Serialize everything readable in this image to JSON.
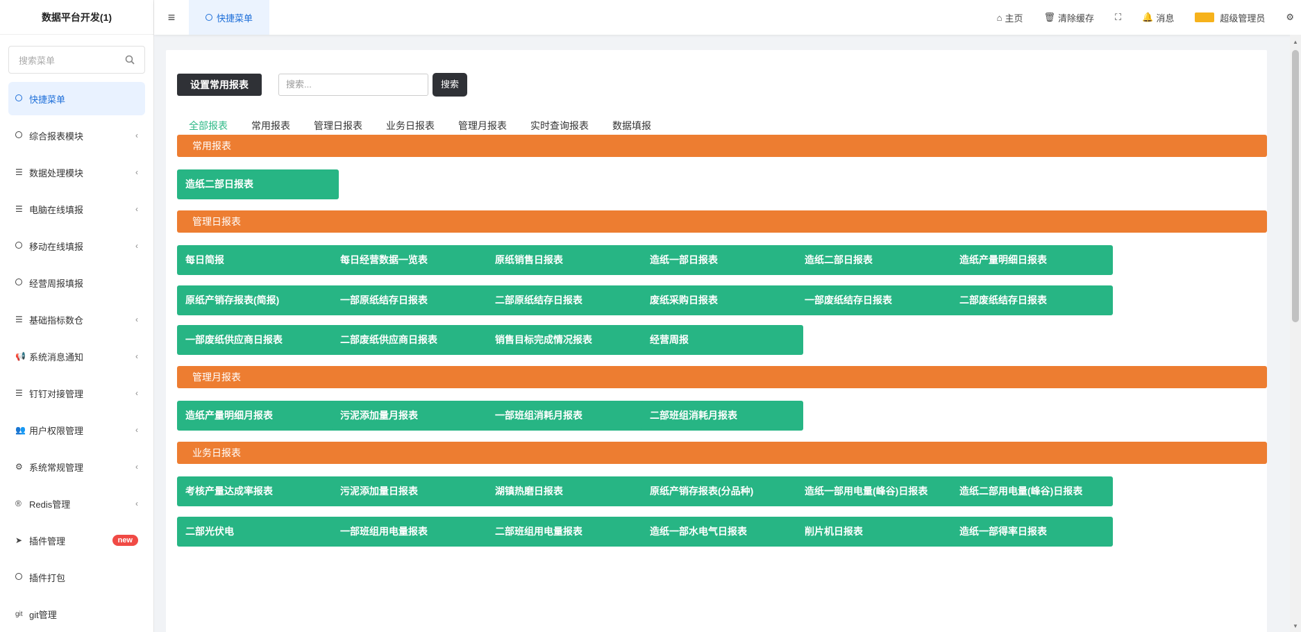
{
  "app": {
    "title": "数据平台开发(1)",
    "search_placeholder": "搜索菜单",
    "menu": [
      {
        "label": "快捷菜单",
        "icon": "circle-icon",
        "arrow": false,
        "active": true
      },
      {
        "label": "综合报表模块",
        "icon": "circle-icon",
        "arrow": true
      },
      {
        "label": "数据处理模块",
        "icon": "list-icon",
        "arrow": true
      },
      {
        "label": "电脑在线填报",
        "icon": "list-icon",
        "arrow": true
      },
      {
        "label": "移动在线填报",
        "icon": "circle-icon",
        "arrow": true
      },
      {
        "label": "经营周报填报",
        "icon": "circle-icon",
        "arrow": false
      },
      {
        "label": "基础指标数仓",
        "icon": "list-icon",
        "arrow": true
      },
      {
        "label": "系统消息通知",
        "icon": "bullhorn-icon",
        "arrow": true
      },
      {
        "label": "钉钉对接管理",
        "icon": "list-icon",
        "arrow": true
      },
      {
        "label": "用户权限管理",
        "icon": "users-icon",
        "arrow": true
      },
      {
        "label": "系统常规管理",
        "icon": "gears-icon",
        "arrow": true
      },
      {
        "label": "Redis管理",
        "icon": "registered-icon",
        "arrow": true
      },
      {
        "label": "插件管理",
        "icon": "rocket-icon",
        "arrow": false,
        "badge": "new"
      },
      {
        "label": "插件打包",
        "icon": "circle-icon",
        "arrow": false
      },
      {
        "label": "git管理",
        "icon": "git-icon",
        "arrow": false
      }
    ]
  },
  "header": {
    "menu_icon": "hamburger-icon",
    "active_tab": "快捷菜单",
    "home": "主页",
    "clear_cache": "清除缓存",
    "messages": "消息",
    "user": "超级管理员"
  },
  "toolbar": {
    "set_common_label": "设置常用报表",
    "search_placeholder": "搜索...",
    "search_label": "搜索"
  },
  "tabs": [
    "全部报表",
    "常用报表",
    "管理日报表",
    "业务日报表",
    "管理月报表",
    "实时查询报表",
    "数据填报"
  ],
  "sections": [
    {
      "title": "常用报表",
      "items": [
        "造纸二部日报表"
      ]
    },
    {
      "title": "管理日报表",
      "items": [
        "每日简报",
        "每日经营数据一览表",
        "原纸销售日报表",
        "造纸一部日报表",
        "造纸二部日报表",
        "造纸产量明细日报表",
        "原纸产销存报表(简报)",
        "一部原纸结存日报表",
        "二部原纸结存日报表",
        "废纸采购日报表",
        "一部废纸结存日报表",
        "二部废纸结存日报表",
        "一部废纸供应商日报表",
        "二部废纸供应商日报表",
        "销售目标完成情况报表",
        "经营周报"
      ]
    },
    {
      "title": "管理月报表",
      "items": [
        "造纸产量明细月报表",
        "污泥添加量月报表",
        "一部班组消耗月报表",
        "二部班组消耗月报表"
      ]
    },
    {
      "title": "业务日报表",
      "items": [
        "考核产量达成率报表",
        "污泥添加量日报表",
        "湖镇热磨日报表",
        "原纸产销存报表(分品种)",
        "造纸一部用电量(峰谷)日报表",
        "造纸二部用电量(峰谷)日报表",
        "二部光伏电",
        "一部班组用电量报表",
        "二部班组用电量报表",
        "造纸一部水电气日报表",
        "削片机日报表",
        "造纸一部得率日报表"
      ]
    }
  ],
  "colors": {
    "section": "#ed7d31",
    "report": "#27b584",
    "accent": "#1e6fd9",
    "tab_active": "#2db886"
  }
}
